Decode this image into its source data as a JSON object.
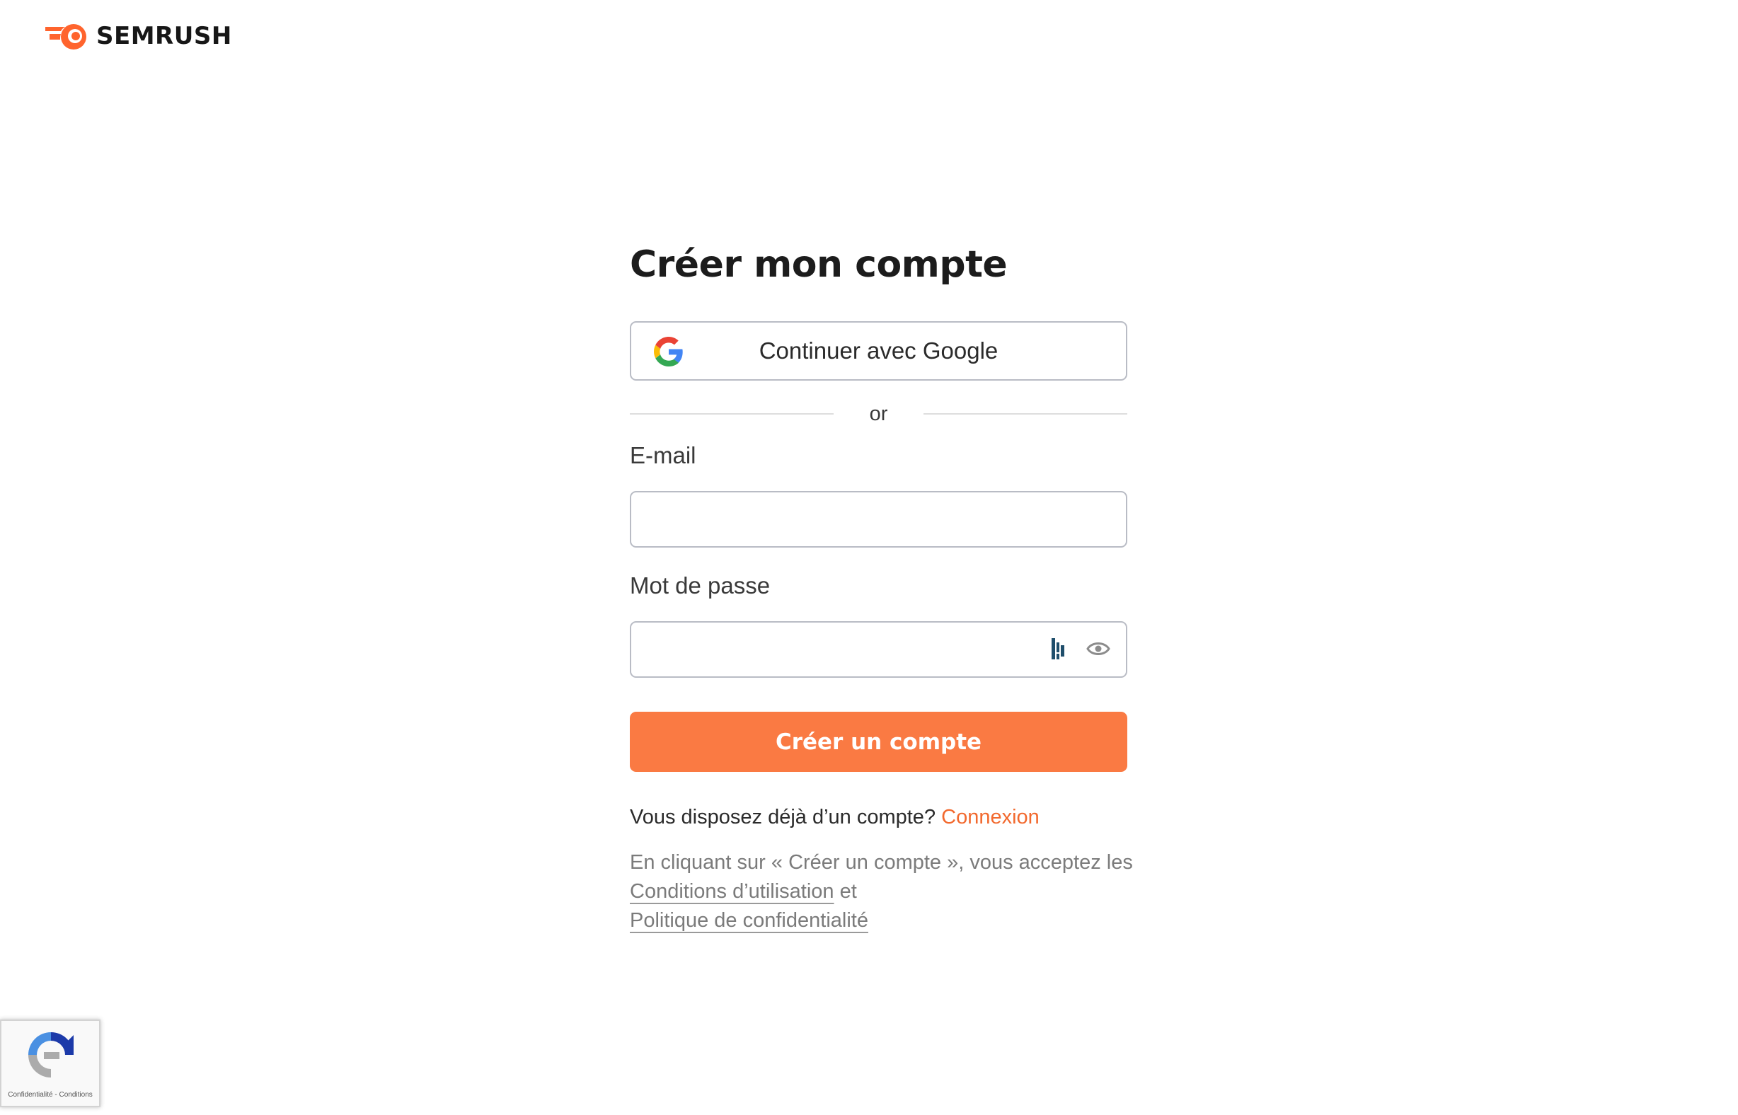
{
  "brand": {
    "name": "SEMRUSH",
    "accent_color": "#fa7a43",
    "logo_icon": "semrush-flame-icon"
  },
  "signup": {
    "title": "Créer mon compte",
    "google_button_label": "Continuer avec Google",
    "google_icon": "google-g-icon",
    "divider_text": "or",
    "email_label": "E-mail",
    "email_value": "",
    "email_placeholder": "",
    "password_label": "Mot de passe",
    "password_value": "",
    "password_placeholder": "",
    "password_icons": [
      "password-manager-icon",
      "eye-icon"
    ],
    "submit_label": "Créer un compte",
    "has_account_text": "Vous disposez déjà d’un compte?",
    "login_link": "Connexion",
    "legal_prefix": "En cliquant sur « Créer un compte », vous acceptez les",
    "terms_link": "Conditions d’utilisation",
    "legal_conjunction": "et",
    "privacy_link": "Politique de confidentialité"
  },
  "recaptcha": {
    "icon": "recaptcha-icon",
    "privacy_link": "Confidentialité",
    "separator": "-",
    "terms_link": "Conditions"
  }
}
